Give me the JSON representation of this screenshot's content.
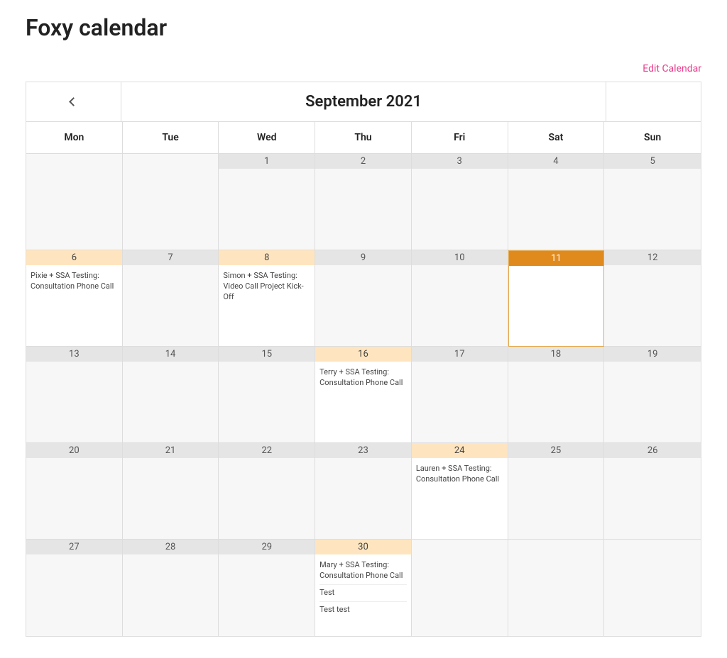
{
  "page_title": "Foxy calendar",
  "edit_link": "Edit Calendar",
  "month_label": "September 2021",
  "days_of_week": [
    "Mon",
    "Tue",
    "Wed",
    "Thu",
    "Fri",
    "Sat",
    "Sun"
  ],
  "weeks": [
    [
      {
        "day": "",
        "blank": true
      },
      {
        "day": "",
        "blank": true
      },
      {
        "day": "1"
      },
      {
        "day": "2"
      },
      {
        "day": "3"
      },
      {
        "day": "4"
      },
      {
        "day": "5"
      }
    ],
    [
      {
        "day": "6",
        "highlight": true,
        "events": [
          "Pixie + SSA Testing: Consultation Phone Call"
        ]
      },
      {
        "day": "7"
      },
      {
        "day": "8",
        "highlight": true,
        "events": [
          "Simon + SSA Testing: Video Call Project Kick-Off"
        ]
      },
      {
        "day": "9"
      },
      {
        "day": "10"
      },
      {
        "day": "11",
        "today": true
      },
      {
        "day": "12"
      }
    ],
    [
      {
        "day": "13"
      },
      {
        "day": "14"
      },
      {
        "day": "15"
      },
      {
        "day": "16",
        "highlight": true,
        "events": [
          "Terry + SSA Testing: Consultation Phone Call"
        ]
      },
      {
        "day": "17"
      },
      {
        "day": "18"
      },
      {
        "day": "19"
      }
    ],
    [
      {
        "day": "20"
      },
      {
        "day": "21"
      },
      {
        "day": "22"
      },
      {
        "day": "23"
      },
      {
        "day": "24",
        "highlight": true,
        "events": [
          "Lauren + SSA Testing: Consultation Phone Call"
        ]
      },
      {
        "day": "25"
      },
      {
        "day": "26"
      }
    ],
    [
      {
        "day": "27"
      },
      {
        "day": "28"
      },
      {
        "day": "29"
      },
      {
        "day": "30",
        "highlight": true,
        "events": [
          "Mary + SSA Testing: Consultation Phone Call",
          "Test",
          "Test test"
        ]
      },
      {
        "day": "",
        "blank": true,
        "trailing": true
      },
      {
        "day": "",
        "blank": true,
        "trailing": true
      },
      {
        "day": "",
        "blank": true,
        "trailing": true
      }
    ]
  ]
}
